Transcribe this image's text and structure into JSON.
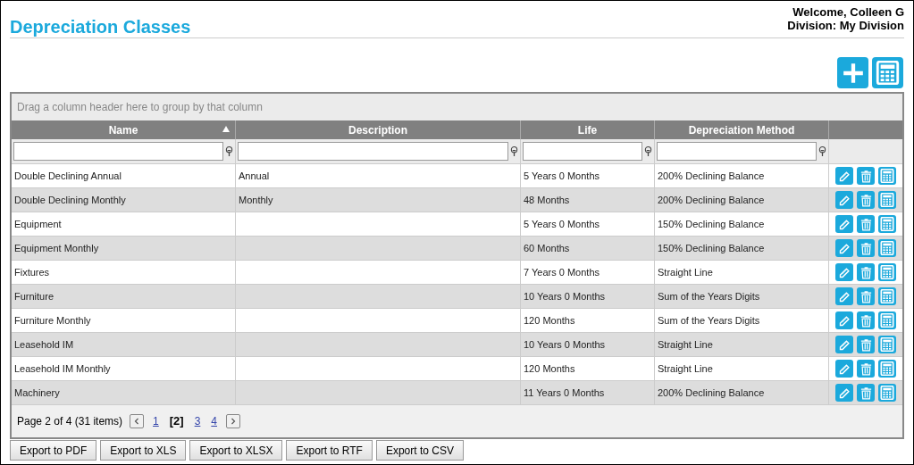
{
  "page_title": "Depreciation Classes",
  "user": {
    "welcome": "Welcome, Colleen G",
    "division": "Division: My Division"
  },
  "grid": {
    "group_panel": "Drag a column header here to group by that column",
    "columns": [
      {
        "label": "Name",
        "sorted": true
      },
      {
        "label": "Description",
        "sorted": false
      },
      {
        "label": "Life",
        "sorted": false
      },
      {
        "label": "Depreciation Method",
        "sorted": false
      }
    ],
    "rows": [
      {
        "name": "Double Declining Annual",
        "description": "Annual",
        "life": "5 Years 0 Months",
        "method": "200% Declining Balance"
      },
      {
        "name": "Double Declining Monthly",
        "description": "Monthly",
        "life": "48 Months",
        "method": "200% Declining Balance"
      },
      {
        "name": "Equipment",
        "life": "5 Years 0 Months",
        "method": "150% Declining Balance"
      },
      {
        "name": "Equipment Monthly",
        "life": "60 Months",
        "method": "150% Declining Balance"
      },
      {
        "name": "Fixtures",
        "life": "7 Years 0 Months",
        "method": "Straight Line"
      },
      {
        "name": "Furniture",
        "life": "10 Years 0 Months",
        "method": "Sum of the Years Digits"
      },
      {
        "name": "Furniture Monthly",
        "life": "120 Months",
        "method": "Sum of the Years Digits"
      },
      {
        "name": "Leasehold IM",
        "life": "10 Years 0 Months",
        "method": "Straight Line"
      },
      {
        "name": "Leasehold IM Monthly",
        "life": "120 Months",
        "method": "Straight Line"
      },
      {
        "name": "Machinery",
        "life": "11 Years 0 Months",
        "method": "200% Declining Balance"
      }
    ],
    "pager": {
      "summary": "Page 2 of 4 (31 items)",
      "pages": [
        {
          "label": "1",
          "selected": false
        },
        {
          "label": "[2]",
          "selected": true
        },
        {
          "label": "3",
          "selected": false
        },
        {
          "label": "4",
          "selected": false
        }
      ]
    }
  },
  "export_buttons": [
    "Export to PDF",
    "Export to XLS",
    "Export to XLSX",
    "Export to RTF",
    "Export to CSV"
  ]
}
